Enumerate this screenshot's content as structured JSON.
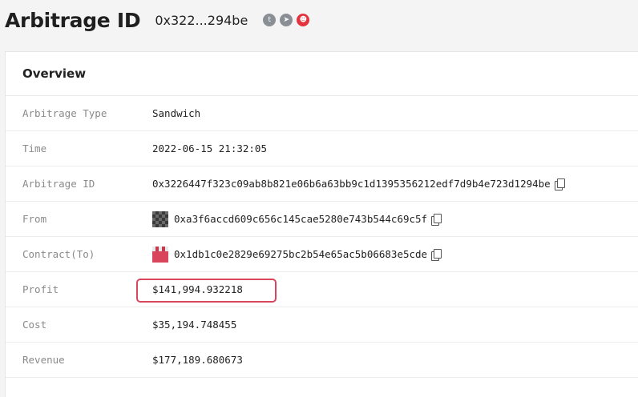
{
  "header": {
    "title": "Arbitrage ID",
    "short_id": "0x322...294be",
    "socials": [
      {
        "icon": "twitter-icon",
        "glyph": "t"
      },
      {
        "icon": "telegram-icon",
        "glyph": "➤"
      },
      {
        "icon": "reddit-icon",
        "glyph": "☻"
      }
    ]
  },
  "overview": {
    "title": "Overview",
    "rows": [
      {
        "label": "Arbitrage Type",
        "value": "Sandwich"
      },
      {
        "label": "Time",
        "value": "2022-06-15 21:32:05"
      },
      {
        "label": "Arbitrage ID",
        "value": "0x3226447f323c09ab8b821e06b6a63bb9c1d1395356212edf7d9b4e723d1294be"
      },
      {
        "label": "From",
        "value": "0xa3f6accd609c656c145cae5280e743b544c69c5f"
      },
      {
        "label": "Contract(To)",
        "value": "0x1db1c0e2829e69275bc2b54e65ac5b06683e5cde"
      },
      {
        "label": "Profit",
        "value": "$141,994.932218"
      },
      {
        "label": "Cost",
        "value": "$35,194.748455"
      },
      {
        "label": "Revenue",
        "value": "$177,189.680673"
      }
    ]
  },
  "colors": {
    "highlight": "#d8465c",
    "reddit": "#e2333f",
    "social_grey": "#8a8f96"
  }
}
